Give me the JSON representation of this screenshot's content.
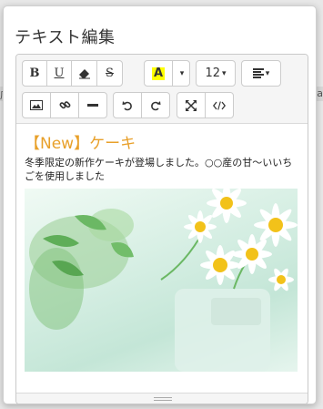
{
  "background": {
    "left_text": "店",
    "right_text": "a"
  },
  "dialog": {
    "title": "テキスト編集"
  },
  "toolbar": {
    "bold": "B",
    "underline": "U",
    "strikethrough": "S",
    "font_color": "A",
    "font_size": "12",
    "caret": "▾"
  },
  "content": {
    "heading": "【New】ケーキ",
    "body": "冬季限定の新作ケーキが登場しました。○○産の甘〜いいちごを使用しました"
  },
  "colors": {
    "heading": "#e8a02a",
    "highlight": "#ffff00"
  }
}
